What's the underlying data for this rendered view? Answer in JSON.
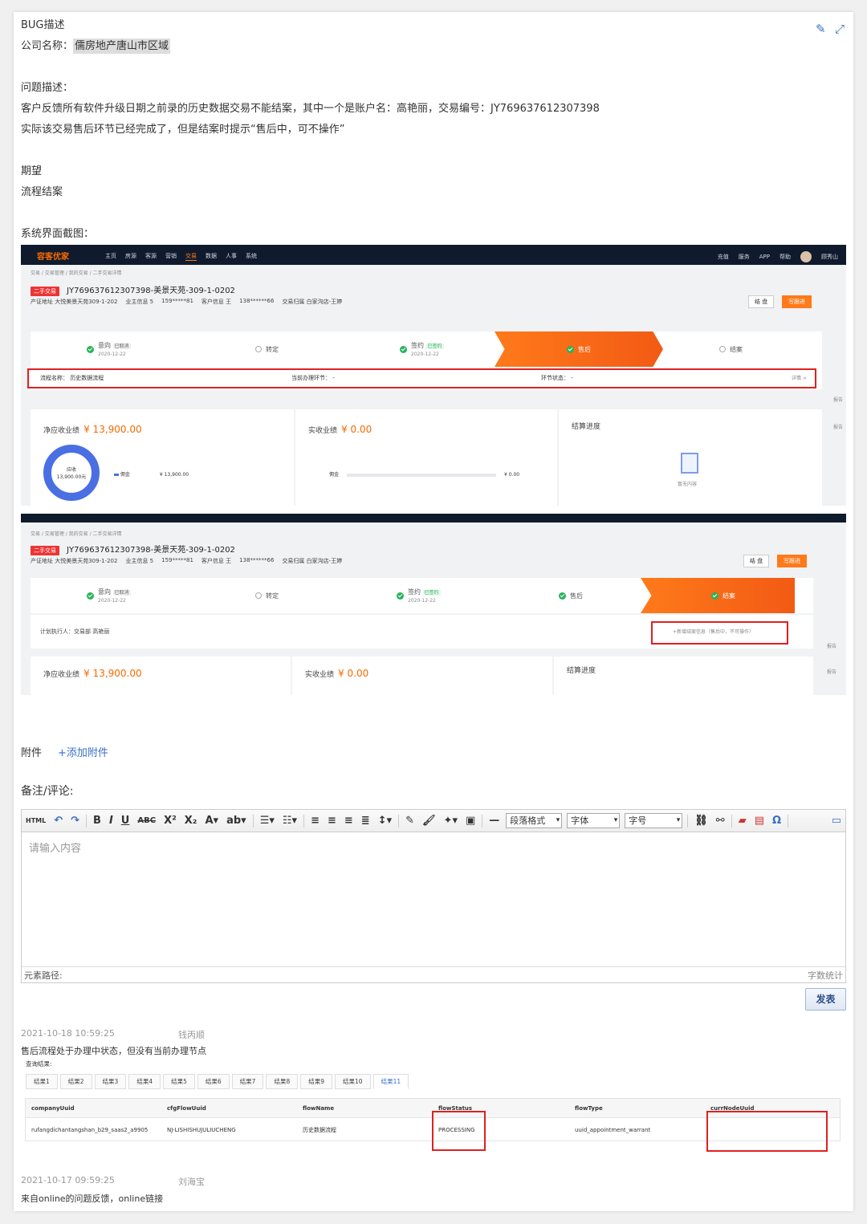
{
  "bug": {
    "section_title": "BUG描述",
    "company_label": "公司名称：",
    "company_value": "儒房地产唐山市区域",
    "problem_label": "问题描述：",
    "problem_line1": "客户反馈所有软件升级日期之前录的历史数据交易不能结案，其中一个是账户名：高艳丽，交易编号：JY769637612307398",
    "problem_line2": "实际该交易售后环节已经完成了，但是结案时提示“售后中，可不操作”",
    "expect_label": "期望",
    "expect_value": "流程结案",
    "screenshot_label": "系统界面截图："
  },
  "app": {
    "logo": "容客优家",
    "nav": [
      "主页",
      "房源",
      "客源",
      "营销",
      "交易",
      "数据",
      "人事",
      "系统"
    ],
    "nav_active": "交易",
    "top_right": [
      "充值",
      "服务",
      "APP",
      "帮助"
    ],
    "user": "顾秀山",
    "breadcrumb": "交易 / 交易管理 / 我的交易 / 二手交易详情",
    "deal_tag": "二手交易",
    "deal_title": "JY769637612307398-美景天苑-309-1-0202",
    "info": [
      "产证地址 大悦美景天苑309-1-202",
      "业主信息 5",
      "159*****81",
      "客户信息 王",
      "138******66",
      "交易归属 白家沟店-王婷"
    ],
    "btn_settle": "结 盘",
    "btn_follow": "写跟进",
    "steps": [
      {
        "name": "意向",
        "badge": "已取消",
        "date": "2020-12-22"
      },
      {
        "name": "转定",
        "badge": "",
        "date": ""
      },
      {
        "name": "签约",
        "badge": "已签约",
        "date": "2020-12-22"
      },
      {
        "name": "售后",
        "badge": "",
        "date": ""
      },
      {
        "name": "结案",
        "badge": "",
        "date": ""
      }
    ],
    "flow_row1": {
      "flow_name_label": "流程名称：",
      "flow_name": "历史数据流程",
      "node_label": "当前办理环节：",
      "node_value": "-",
      "status_label": "环节状态：",
      "status_value": "-",
      "detail": "详情 >"
    },
    "flow_row2": {
      "executor": "计划执行人：交易部 高艳丽",
      "add_hint": "+新增结案信息（售后中，不可操作）"
    },
    "perf_label": "净应收业绩",
    "perf_value": "¥ 13,900.00",
    "actual_label": "实收业绩",
    "actual_value": "¥ 0.00",
    "progress_label": "结算进度",
    "donut_label": "应收",
    "donut_value": "13,900.00元",
    "legend_name": "佣金",
    "legend_value": "¥ 13,900.00",
    "bar_label": "佣金",
    "bar_value": "¥ 0.00",
    "empty_text": "暂无内容",
    "side": [
      "报告",
      "报告"
    ]
  },
  "attach": {
    "label": "附件",
    "add": "+添加附件"
  },
  "comment": {
    "label": "备注/评论:"
  },
  "editor": {
    "html_btn": "HTML",
    "para_format": "段落格式",
    "font": "字体",
    "font_size": "字号",
    "placeholder": "请输入内容",
    "path_label": "元素路径:",
    "word_count": "字数统计",
    "submit": "发表"
  },
  "comments": [
    {
      "time": "2021-10-18 10:59:25",
      "author": "钱丙顺",
      "text": "售后流程处于办理中状态，但没有当前办理节点"
    },
    {
      "time": "2021-10-17 09:59:25",
      "author": "刘海宝",
      "text": "来自online的问题反馈，online链接"
    }
  ],
  "query": {
    "label": "查询结果:",
    "tabs": [
      "结果1",
      "结果2",
      "结果3",
      "结果4",
      "结果5",
      "结果6",
      "结果7",
      "结果8",
      "结果9",
      "结果10",
      "结果11"
    ],
    "active_tab": "结果11",
    "headers": [
      "companyUuid",
      "cfgFlowUuid",
      "flowName",
      "flowStatus",
      "flowType",
      "currNodeUuid"
    ],
    "row": [
      "rufangdichantangshan_b29_saas2_a9905",
      "NJ-LISHISHUJULIUCHENG",
      "历史数据流程",
      "PROCESSING",
      "uuid_appointment_warrant",
      ""
    ]
  }
}
